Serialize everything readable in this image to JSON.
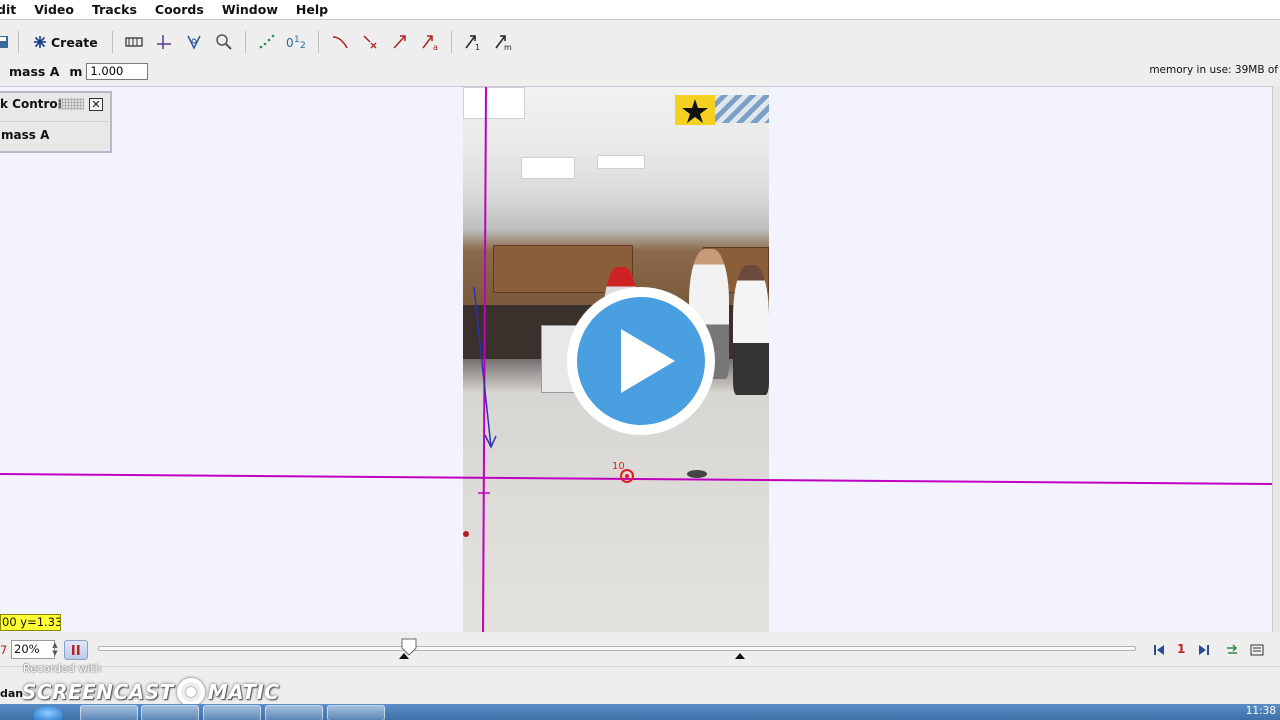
{
  "menu": [
    "dit",
    "Video",
    "Tracks",
    "Coords",
    "Window",
    "Help"
  ],
  "toolbar": {
    "create_label": "Create",
    "calib_label": "0¹₂",
    "vec_a_sub": "1",
    "vec_b_sub": "m"
  },
  "trackbar": {
    "track_name": "mass A",
    "mass_label": "m",
    "mass_value": "1.000",
    "memory": "memory in use: 39MB of"
  },
  "track_control": {
    "title": "k Control",
    "items": [
      "mass A"
    ]
  },
  "overlay": {
    "point_label": "10"
  },
  "readout": {
    "text": "00  y=1.33"
  },
  "player": {
    "frame_left": "7",
    "rate": "20%",
    "step_count": "1",
    "slider_position": 0.3
  },
  "status": {
    "user": "dan",
    "recorded_with": "Recorded with",
    "watermark_left": "SCREENCAST",
    "watermark_right": "MATIC"
  },
  "taskbar": {
    "clock": "11:38"
  },
  "colors": {
    "axis": "#c000c0",
    "track_point": "#e02020",
    "vector": "#3030b0",
    "play_button": "#4a9fe0",
    "readout_bg": "#ffff33"
  }
}
